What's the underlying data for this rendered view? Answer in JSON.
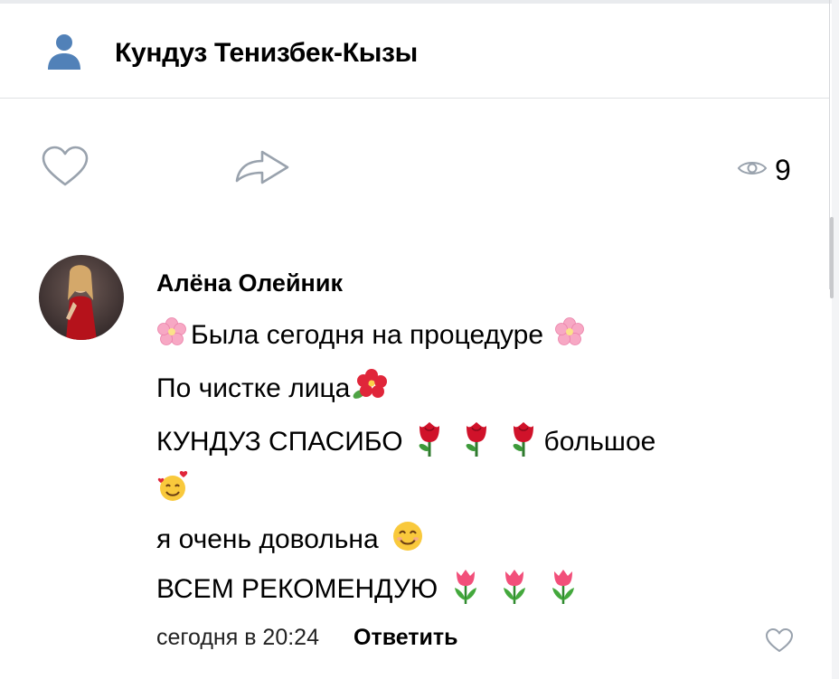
{
  "header": {
    "title": "Кундуз Тенизбек-Кызы",
    "icon": "user-icon"
  },
  "post_actions": {
    "like_icon": "heart-icon",
    "share_icon": "share-arrow-icon",
    "views_icon": "eye-icon",
    "views_count": "9"
  },
  "comment": {
    "author": "Алёна Олейник",
    "lines": [
      {
        "text": "Была сегодня на процедуре",
        "emojis": [
          "cherry-blossom",
          "cherry-blossom"
        ]
      },
      {
        "text": "По чистке лица",
        "emojis": [
          "hibiscus"
        ]
      },
      {
        "text": "КУНДУЗ СПАСИБО",
        "emojis": [
          "rose",
          "rose",
          "rose"
        ],
        "after": "большое"
      },
      {
        "text": "",
        "emojis": [
          "smiling-face-with-hearts"
        ]
      },
      {
        "text": "я очень довольна",
        "emojis": [
          "smiling-face"
        ]
      },
      {
        "text": "ВСЕМ РЕКОМЕНДУЮ",
        "emojis": [
          "tulip",
          "tulip",
          "tulip"
        ]
      }
    ],
    "date": "сегодня в 20:24",
    "reply_label": "Ответить",
    "like_icon": "heart-icon"
  },
  "colors": {
    "icon_blue": "#5181b8",
    "icon_gray": "#99a2ad",
    "divider": "#dfe1e4"
  }
}
